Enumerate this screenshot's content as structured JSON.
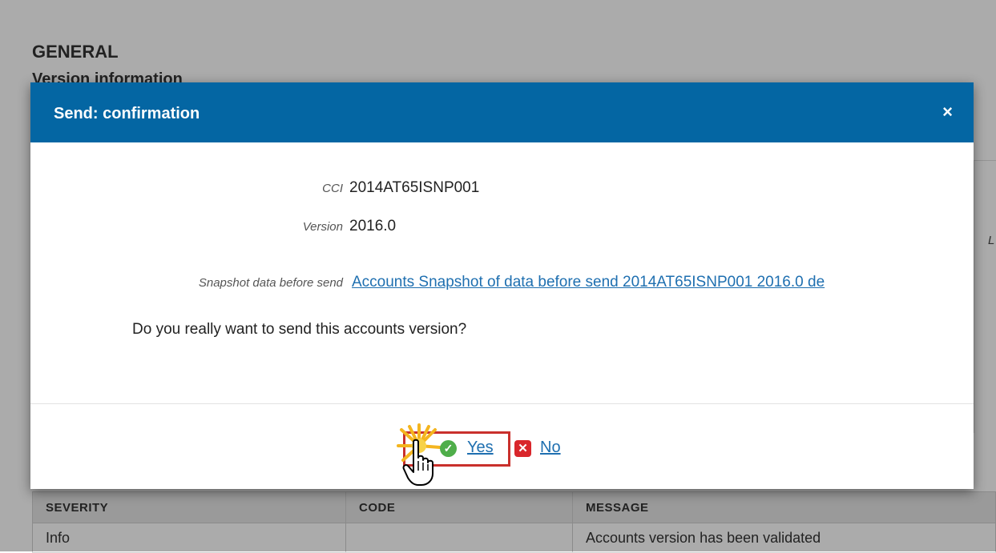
{
  "background": {
    "general_title": "GENERAL",
    "version_info_title": "Version information",
    "side_letter": "L",
    "messages_table": {
      "headers": [
        "SEVERITY",
        "CODE",
        "MESSAGE"
      ],
      "rows": [
        [
          "Info",
          "",
          "Accounts version has been validated"
        ]
      ]
    }
  },
  "dialog": {
    "title": "Send: confirmation",
    "close_glyph": "×",
    "fields": {
      "cci_label": "CCI",
      "cci_value": "2014AT65ISNP001",
      "version_label": "Version",
      "version_value": "2016.0",
      "snapshot_label": "Snapshot data before send",
      "snapshot_link": "Accounts Snapshot of data before send 2014AT65ISNP001 2016.0 de"
    },
    "question": "Do you really want to send this accounts version?",
    "actions": {
      "yes_label": "Yes",
      "yes_icon": "check-circle-icon",
      "no_label": "No",
      "no_icon": "close-square-icon"
    }
  },
  "colors": {
    "header_blue": "#0466a3",
    "link_blue": "#1e6fb0",
    "highlight_red": "#c9302c",
    "yes_green": "#4fae4a",
    "no_red": "#d9262b"
  }
}
